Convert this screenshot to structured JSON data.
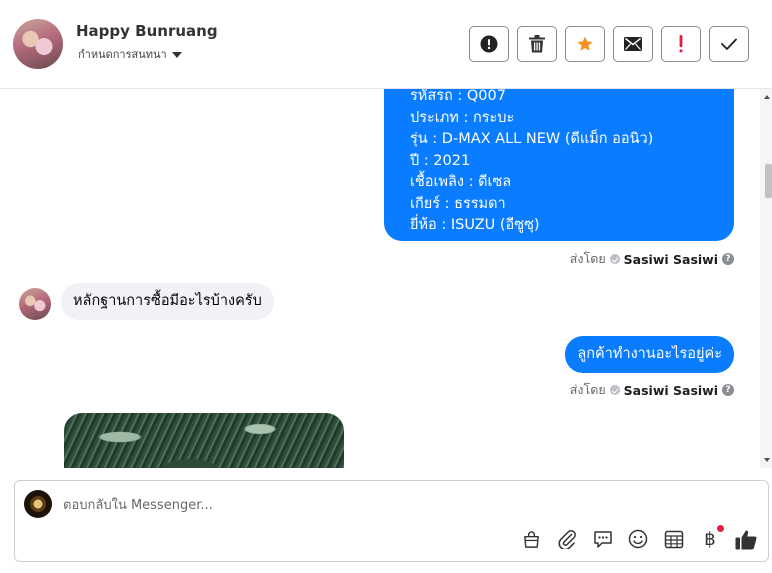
{
  "header": {
    "contact_name": "Happy Bunruang",
    "assign_label": "กำหนดการสนทนา",
    "actions": [
      {
        "name": "report",
        "icon": "alert-circle-icon"
      },
      {
        "name": "delete",
        "icon": "trash-icon",
        "color": "#444444"
      },
      {
        "name": "star",
        "icon": "star-icon",
        "color": "#f5901e"
      },
      {
        "name": "mark-unread",
        "icon": "mail-icon"
      },
      {
        "name": "spam",
        "icon": "exclamation-icon",
        "color": "#e41e3f"
      },
      {
        "name": "done",
        "icon": "check-icon"
      }
    ]
  },
  "messages": {
    "vehicle_info": [
      "รหัสรถ : Q007",
      "ประเภท : กระบะ",
      "รุ่น : D-MAX ALL NEW (ดีแม็ก ออนิว)",
      "ปี : 2021",
      "เชื้อเพลิง : ดีเซล",
      "เกียร์ : ธรรมดา",
      "ยี่ห้อ : ISUZU (อีซูซุ)"
    ],
    "sent_by_label": "ส่งโดย",
    "sender_name": "Sasiwi Sasiwi",
    "incoming_text": "หลักฐานการซื้อมีอะไรบ้างครับ",
    "outgoing_text": "ลูกค้าทำงานอะไรอยู่ค่ะ"
  },
  "composer": {
    "placeholder": "ตอบกลับใน Messenger...",
    "icons": [
      "shopping-bag-icon",
      "paperclip-icon",
      "saved-reply-icon",
      "emoji-icon",
      "appointment-icon",
      "baht-payment-icon",
      "like-icon"
    ],
    "baht_symbol": "฿"
  },
  "colors": {
    "accent": "#0a7cff",
    "star": "#f5901e",
    "danger": "#e41e3f",
    "incoming_bubble": "#f0f2f5"
  }
}
